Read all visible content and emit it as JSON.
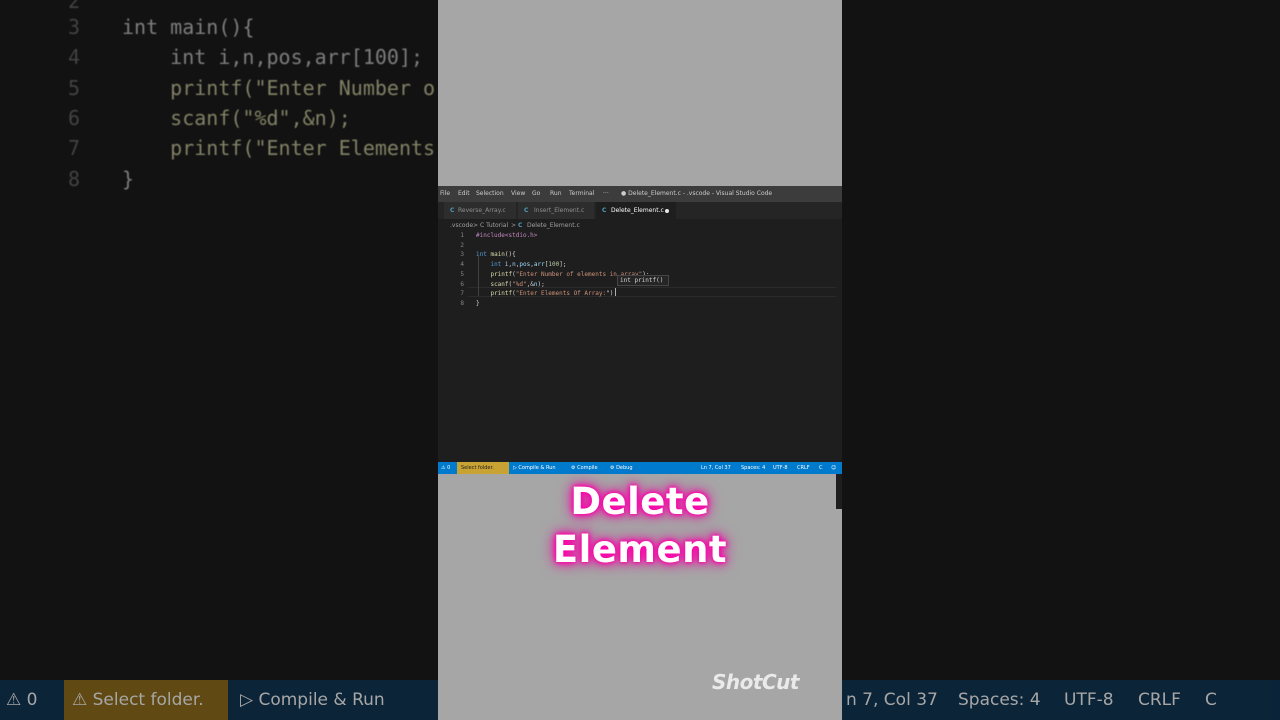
{
  "background": {
    "lines": [
      {
        "num": "2",
        "text": ""
      },
      {
        "num": "3",
        "text": "int main(){"
      },
      {
        "num": "4",
        "text": "    int i,n,pos,arr[100];"
      },
      {
        "num": "5",
        "text": "    printf(\"Enter Number o"
      },
      {
        "num": "6",
        "text": "    scanf(\"%d\",&n);"
      },
      {
        "num": "7",
        "text": "    printf(\"Enter Elements"
      },
      {
        "num": "8",
        "text": "}"
      }
    ],
    "status": {
      "problems": "⚠ 0",
      "select_folder": "⚠ Select folder.",
      "compile_run": "▷ Compile & Run",
      "position": "n 7, Col 37",
      "spaces": "Spaces: 4",
      "encoding": "UTF-8",
      "eol": "CRLF",
      "lang": "C"
    }
  },
  "window": {
    "menu": [
      "File",
      "Edit",
      "Selection",
      "View",
      "Go",
      "Run",
      "Terminal",
      "···"
    ],
    "title": "● Delete_Element.c - .vscode - Visual Studio Code"
  },
  "tabs": [
    {
      "icon": "C",
      "label": "Reverse_Array.c"
    },
    {
      "icon": "C",
      "label": "Insert_Element.c"
    },
    {
      "icon": "C",
      "label": "Delete_Element.c"
    }
  ],
  "breadcrumb": {
    "root": ".vscode",
    "sep": ">",
    "folder": "C Tutorial",
    "file_icon": "C",
    "file": "Delete_Element.c"
  },
  "editor": {
    "lines": [
      {
        "num": "1",
        "tokens": [
          [
            "inc",
            "#include<stdio.h>"
          ]
        ]
      },
      {
        "num": "2",
        "tokens": []
      },
      {
        "num": "3",
        "tokens": [
          [
            "kw",
            "int"
          ],
          [
            "plain",
            " "
          ],
          [
            "fn",
            "main"
          ],
          [
            "plain",
            "(){"
          ]
        ]
      },
      {
        "num": "4",
        "tokens": [
          [
            "plain",
            "    "
          ],
          [
            "kw",
            "int"
          ],
          [
            "plain",
            " "
          ],
          [
            "var",
            "i"
          ],
          [
            "plain",
            ","
          ],
          [
            "var",
            "n"
          ],
          [
            "plain",
            ","
          ],
          [
            "var",
            "pos"
          ],
          [
            "plain",
            ","
          ],
          [
            "var",
            "arr"
          ],
          [
            "plain",
            "["
          ],
          [
            "num",
            "100"
          ],
          [
            "plain",
            "];"
          ]
        ]
      },
      {
        "num": "5",
        "tokens": [
          [
            "plain",
            "    "
          ],
          [
            "fn",
            "printf"
          ],
          [
            "plain",
            "("
          ],
          [
            "str",
            "\"Enter Number of elements in array\""
          ],
          [
            "plain",
            ");"
          ]
        ]
      },
      {
        "num": "6",
        "tokens": [
          [
            "plain",
            "    "
          ],
          [
            "fn",
            "scanf"
          ],
          [
            "plain",
            "("
          ],
          [
            "str",
            "\"%d\""
          ],
          [
            "plain",
            ",&"
          ],
          [
            "var",
            "n"
          ],
          [
            "plain",
            ");"
          ]
        ]
      },
      {
        "num": "7",
        "tokens": [
          [
            "plain",
            "    "
          ],
          [
            "fn",
            "printf"
          ],
          [
            "plain",
            "("
          ],
          [
            "str",
            "\"Enter Elements Of Array:"
          ],
          [
            "plain",
            "\")"
          ]
        ]
      },
      {
        "num": "8",
        "tokens": [
          [
            "plain",
            "}"
          ]
        ]
      }
    ],
    "hover": "int printf()"
  },
  "statusbar": {
    "problems": "⚠ 0",
    "select_folder": "Select folder.",
    "compile_run": "▷ Compile & Run",
    "compile": "⚙ Compile",
    "debug": "⚙ Debug",
    "position": "Ln 7, Col 37",
    "spaces": "Spaces: 4",
    "encoding": "UTF-8",
    "eol": "CRLF",
    "lang": "C"
  },
  "caption": {
    "line1": "Delete",
    "line2": "Element"
  },
  "watermark": "ShotCut",
  "colors": {
    "accent": "#007acc",
    "caption_glow": "#ff00aa"
  }
}
